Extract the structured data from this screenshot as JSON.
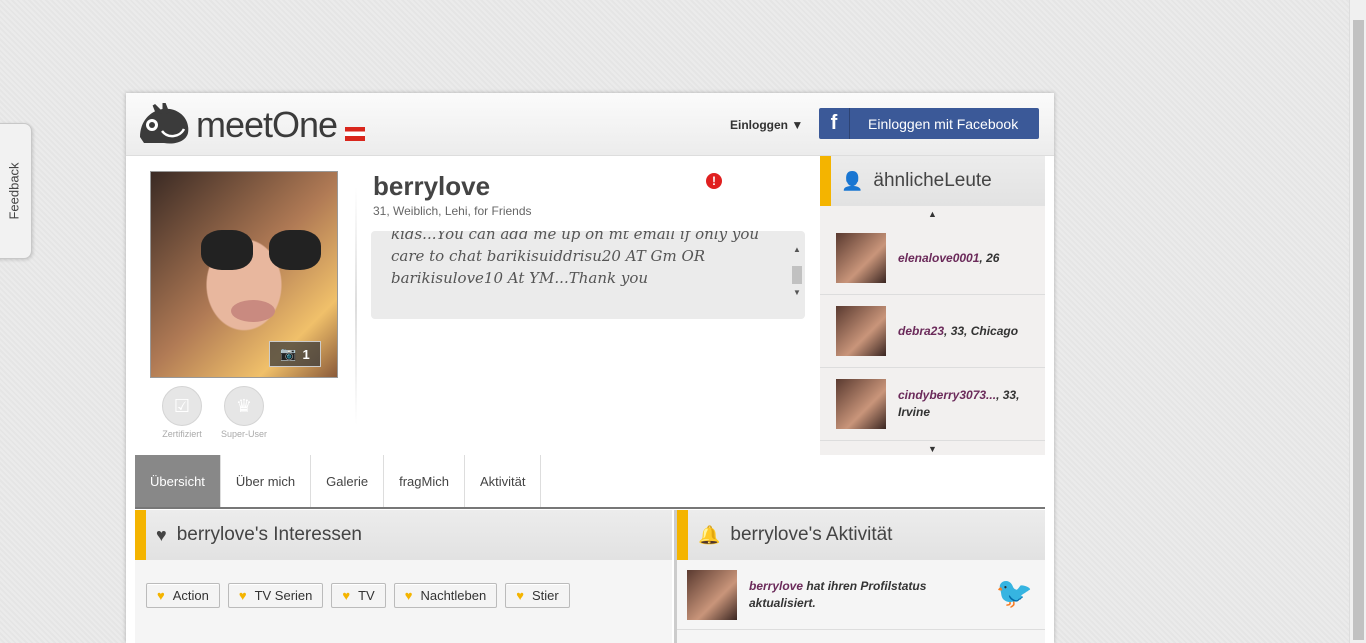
{
  "feedback": {
    "label": "Feedback"
  },
  "header": {
    "logo_text": "meetOne",
    "login_label": "Einloggen ▼",
    "facebook_label": "Einloggen mit Facebook",
    "facebook_icon": "f"
  },
  "profile": {
    "name": "berrylove",
    "details": "31, Weiblich, Lehi, for Friends",
    "photo_count": "1",
    "about_text": "kids...You can add me up on mt email if only you care to chat barikisuiddrisu20 AT Gm OR barikisulove10 At YM...Thank you",
    "badges": [
      {
        "label": "Zertifiziert"
      },
      {
        "label": "Super-User"
      }
    ]
  },
  "similar": {
    "title": "ähnlicheLeute",
    "people": [
      {
        "name": "elenalove0001",
        "rest": ", 26"
      },
      {
        "name": "debra23",
        "rest": ", 33, Chicago"
      },
      {
        "name": "cindyberry3073...",
        "rest": ", 33, Irvine"
      }
    ]
  },
  "tabs": [
    {
      "label": "Übersicht",
      "active": true
    },
    {
      "label": "Über mich"
    },
    {
      "label": "Galerie"
    },
    {
      "label": "fragMich"
    },
    {
      "label": "Aktivität"
    }
  ],
  "interests": {
    "title": "berrylove's Interessen",
    "tags": [
      "Action",
      "TV Serien",
      "TV",
      "Nachtleben",
      "Stier"
    ]
  },
  "activity": {
    "title": "berrylove's Aktivität",
    "items": [
      {
        "name": "berrylove",
        "text": " hat ihren Profilstatus aktualisiert."
      }
    ]
  },
  "colors": {
    "accent": "#f4b400",
    "facebook": "#3b5998",
    "username": "#6b2a5a"
  }
}
